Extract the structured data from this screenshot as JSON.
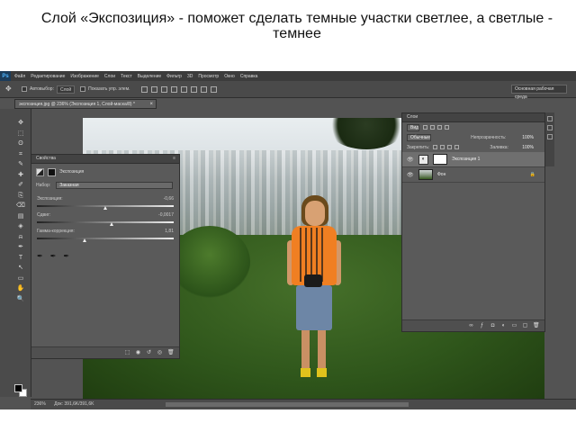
{
  "slide_title": "Слой «Экспозиция»  - поможет сделать темные участки светлее, а светлые - темнее",
  "app": {
    "logo": "Ps",
    "menu": [
      "Файл",
      "Редактирование",
      "Изображение",
      "Слои",
      "Текст",
      "Выделение",
      "Фильтр",
      "3D",
      "Просмотр",
      "Окно",
      "Справка"
    ]
  },
  "options_bar": {
    "tool_icon": "move-icon",
    "autoselect_label": "Автовыбор:",
    "autoselect_value": "Слой",
    "show_controls_label": "Показать упр. элем.",
    "workspace": "Основная рабочая среда"
  },
  "document_tab": {
    "title": "экспозиция.jpg @ 236% (Экспозиция 1, Слой-маска/8) *",
    "close": "×"
  },
  "toolbar": {
    "tools": [
      "✥",
      "⬚",
      "ʘ",
      "⌗",
      "✎",
      "✚",
      "✐",
      "⎘",
      "⌫",
      "▤",
      "◈",
      "⍾",
      "✒",
      "T",
      "↖",
      "▭",
      "✋",
      "🔍"
    ]
  },
  "properties": {
    "panel_title": "Свойства",
    "adjustment_name": "Экспозиция",
    "preset_label": "Набор:",
    "preset_value": "Заказная",
    "sliders": [
      {
        "label": "Экспозиция:",
        "value": "-0,66",
        "position": 0.5
      },
      {
        "label": "Сдвиг:",
        "value": "-0,0017",
        "position": 0.55
      },
      {
        "label": "Гамма-коррекция:",
        "value": "1,81",
        "position": 0.35
      }
    ],
    "eyedroppers": [
      "eyedropper-black-icon",
      "eyedropper-gray-icon",
      "eyedropper-white-icon"
    ]
  },
  "layers": {
    "panel_title": "Слои",
    "kind_label": "Вид",
    "blend_mode": "Обычные",
    "opacity_label": "Непрозрачность:",
    "opacity_value": "100%",
    "lock_label": "Закрепить:",
    "fill_label": "Заливка:",
    "fill_value": "100%",
    "items": [
      {
        "name": "Экспозиция 1",
        "active": true
      },
      {
        "name": "Фон",
        "active": false
      }
    ]
  },
  "status": {
    "zoom": "236%",
    "doc": "Док: 391,6K/391,6K"
  }
}
